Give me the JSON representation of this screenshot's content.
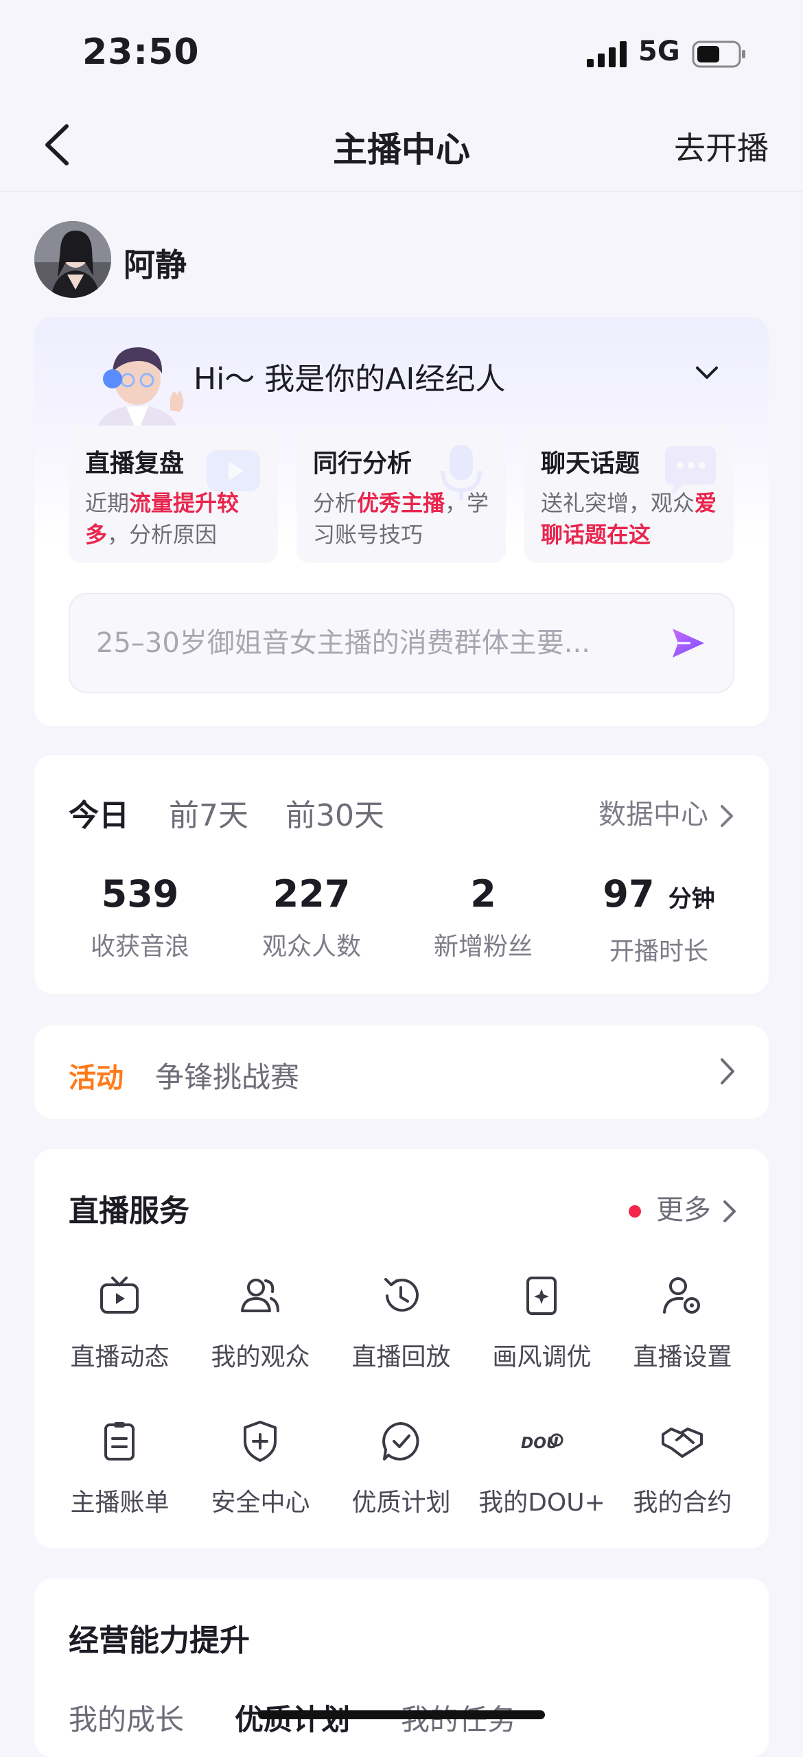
{
  "status_bar": {
    "time": "23:50",
    "network": "5G"
  },
  "nav": {
    "title": "主播中心",
    "go_live": "去开播"
  },
  "user": {
    "name": "阿静"
  },
  "ai_agent": {
    "greeting": "Hi～ 我是你的AI经纪人",
    "tiles": [
      {
        "title": "直播复盘",
        "desc_before": "近期",
        "desc_highlight": "流量提升较多",
        "desc_after": "，分析原因"
      },
      {
        "title": "同行分析",
        "desc_before": "分析",
        "desc_highlight": "优秀主播",
        "desc_after": "，学习账号技巧"
      },
      {
        "title": "聊天话题",
        "desc_before": "送礼突增，观众",
        "desc_highlight": "爱聊话题在这",
        "desc_after": ""
      }
    ],
    "input_placeholder": "25–30岁御姐音女主播的消费群体主要..."
  },
  "stats": {
    "tabs": [
      "今日",
      "前7天",
      "前30天"
    ],
    "active_tab": "今日",
    "data_center": "数据中心",
    "items": [
      {
        "value": "539",
        "unit": "",
        "label": "收获音浪"
      },
      {
        "value": "227",
        "unit": "",
        "label": "观众人数"
      },
      {
        "value": "2",
        "unit": "",
        "label": "新增粉丝"
      },
      {
        "value": "97",
        "unit": "分钟",
        "label": "开播时长"
      }
    ]
  },
  "activity": {
    "tag": "活动",
    "text": "争锋挑战赛"
  },
  "live_services": {
    "title": "直播服务",
    "more": "更多",
    "items": [
      {
        "label": "直播动态",
        "icon": "tv-play-icon"
      },
      {
        "label": "我的观众",
        "icon": "audience-icon"
      },
      {
        "label": "直播回放",
        "icon": "replay-clock-icon"
      },
      {
        "label": "画风调优",
        "icon": "image-sparkle-icon"
      },
      {
        "label": "直播设置",
        "icon": "user-settings-icon"
      },
      {
        "label": "主播账单",
        "icon": "bill-clipboard-icon"
      },
      {
        "label": "安全中心",
        "icon": "shield-plus-icon"
      },
      {
        "label": "优质计划",
        "icon": "check-badge-icon"
      },
      {
        "label": "我的DOU+",
        "icon": "dou-plus-icon"
      },
      {
        "label": "我的合约",
        "icon": "handshake-icon"
      }
    ]
  },
  "growth": {
    "title": "经营能力提升",
    "tabs": [
      "我的成长",
      "优质计划",
      "我的任务"
    ],
    "active_tab": "优质计划"
  },
  "colors": {
    "accent_red": "#e8264e",
    "activity_orange": "#ff7a1a",
    "send_purple": "#a855f7",
    "page_bg": "#f5f5fb"
  }
}
